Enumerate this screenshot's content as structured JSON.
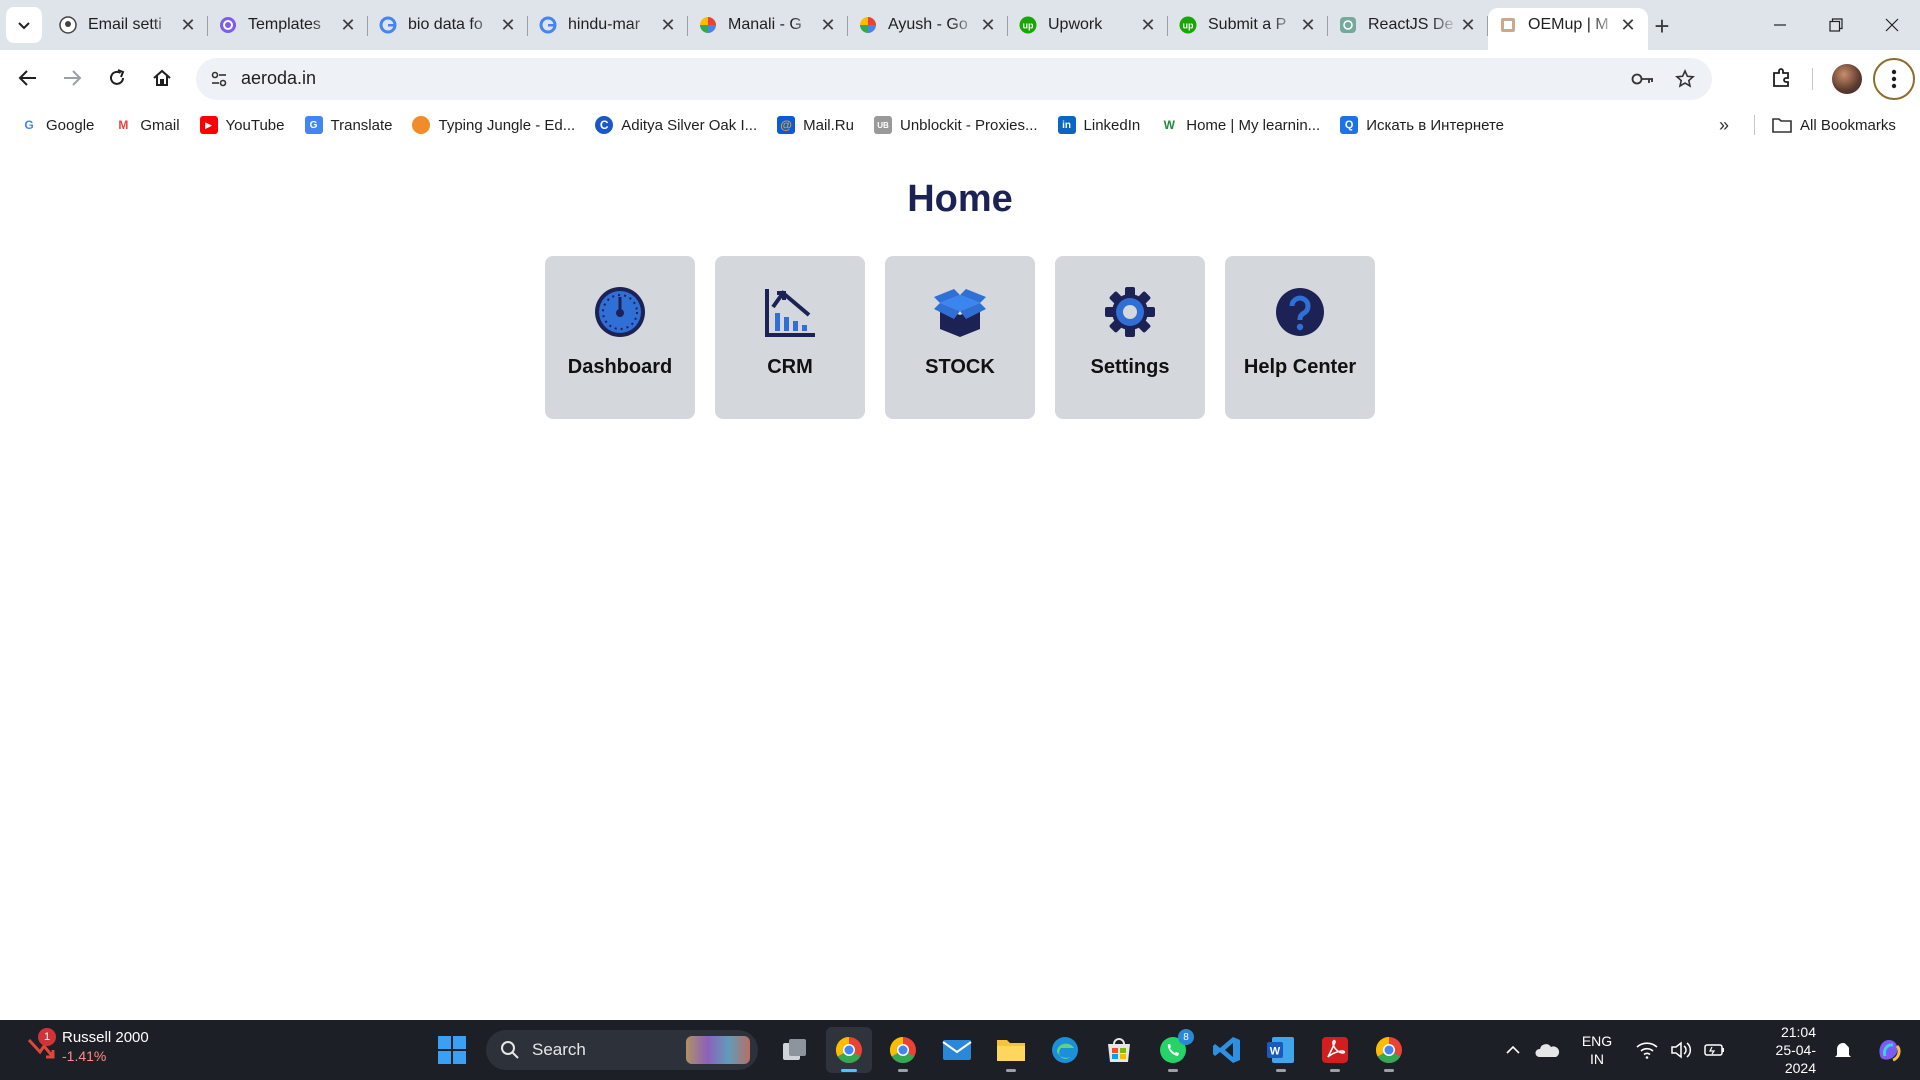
{
  "browser": {
    "tabs": [
      {
        "title": "Email setti",
        "icon": "github-icon"
      },
      {
        "title": "Templates",
        "icon": "canva-icon"
      },
      {
        "title": "bio data fo",
        "icon": "google-icon"
      },
      {
        "title": "hindu-mar",
        "icon": "google-icon"
      },
      {
        "title": "Manali - G",
        "icon": "google-photos-icon"
      },
      {
        "title": "Ayush - Go",
        "icon": "google-photos-icon"
      },
      {
        "title": "Upwork",
        "icon": "upwork-icon"
      },
      {
        "title": "Submit a P",
        "icon": "upwork-icon"
      },
      {
        "title": "ReactJS De",
        "icon": "chatgpt-icon"
      },
      {
        "title": "OEMup | M",
        "icon": "site-icon",
        "active": true
      }
    ],
    "new_tab_label": "+",
    "url": "aeroda.in",
    "bookmarks": [
      {
        "label": "Google",
        "icon": "google-icon"
      },
      {
        "label": "Gmail",
        "icon": "gmail-icon"
      },
      {
        "label": "YouTube",
        "icon": "youtube-icon"
      },
      {
        "label": "Translate",
        "icon": "translate-icon"
      },
      {
        "label": "Typing Jungle - Ed...",
        "icon": "typing-jungle-icon"
      },
      {
        "label": "Aditya Silver Oak I...",
        "icon": "aditya-icon"
      },
      {
        "label": "Mail.Ru",
        "icon": "mailru-icon"
      },
      {
        "label": "Unblockit - Proxies...",
        "icon": "unblockit-icon"
      },
      {
        "label": "LinkedIn",
        "icon": "linkedin-icon"
      },
      {
        "label": "Home | My learnin...",
        "icon": "w-icon"
      },
      {
        "label": "Искать в Интернете",
        "icon": "search-icon"
      }
    ],
    "all_bookmarks": "All Bookmarks",
    "bookmark_overflow": "»"
  },
  "page": {
    "title": "Home",
    "cards": [
      {
        "label": "Dashboard",
        "icon": "speedometer-icon"
      },
      {
        "label": "CRM",
        "icon": "chart-icon"
      },
      {
        "label": "STOCK",
        "icon": "box-icon"
      },
      {
        "label": "Settings",
        "icon": "gear-icon"
      },
      {
        "label": "Help Center",
        "icon": "question-icon"
      }
    ]
  },
  "taskbar": {
    "widget_name": "Russell 2000",
    "widget_value": "-1.41%",
    "widget_badge": "1",
    "search_label": "Search",
    "whatsapp_badge": "8",
    "lang_line1": "ENG",
    "lang_line2": "IN",
    "time": "21:04",
    "date": "25-04-2024"
  },
  "colors": {
    "title": "#1c2354",
    "card_bg": "#d4d7dc",
    "icon_blue": "#2f6fd6",
    "icon_navy": "#1c2354"
  }
}
